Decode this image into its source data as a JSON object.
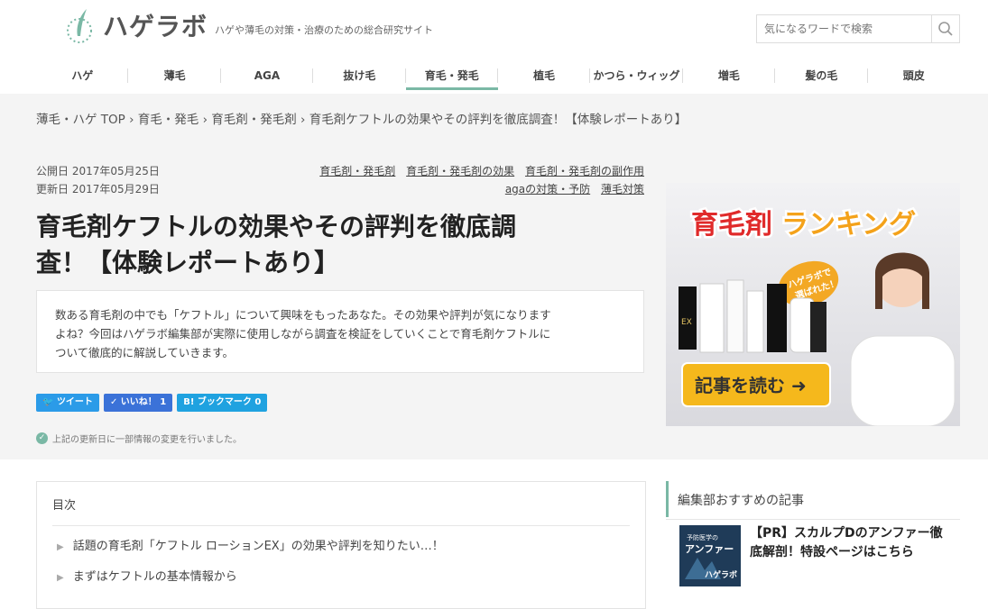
{
  "header": {
    "logo_text": "ハゲラボ",
    "tagline": "ハゲや薄毛の対策・治療のための総合研究サイト",
    "search_placeholder": "気になるワードで検索",
    "accent_color": "#7ab8a5"
  },
  "nav": {
    "items": [
      {
        "label": "ハゲ"
      },
      {
        "label": "薄毛"
      },
      {
        "label": "AGA"
      },
      {
        "label": "抜け毛"
      },
      {
        "label": "育毛・発毛"
      },
      {
        "label": "植毛"
      },
      {
        "label": "かつら・ウィッグ"
      },
      {
        "label": "増毛"
      },
      {
        "label": "髪の毛"
      },
      {
        "label": "頭皮"
      }
    ],
    "active": "育毛・発毛"
  },
  "breadcrumb": {
    "text": "薄毛・ハゲ TOP › 育毛・発毛 › 育毛剤・発毛剤 › 育毛剤ケフトルの効果やその評判を徹底調査！【体験レポートあり】"
  },
  "article": {
    "published": "公開日 2017年05月25日",
    "updated": "更新日 2017年05月29日",
    "tags_row1": [
      "育毛剤・発毛剤",
      "育毛剤・発毛剤の効果",
      "育毛剤・発毛剤の副作用"
    ],
    "tags_row2": [
      "agaの対策・予防",
      "薄毛対策"
    ],
    "title_line1": "育毛剤ケフトルの効果やその評判を徹底調",
    "title_line2": "査！【体験レポートあり】",
    "intro_line1": "数ある育毛剤の中でも「ケフトル」について興味をもったあなた。その効果や評判が気になります",
    "intro_line2": "よね？今回はハゲラボ編集部が実際に使用しながら調査を検証をしていくことで育毛剤ケフトルに",
    "intro_line3": "ついて徹底的に解説していきます。",
    "social": {
      "tweet": "ツイート",
      "like": "✓ いいね！ 1",
      "bookmark": "B! ブックマーク 0"
    },
    "update_note": "上記の更新日に一部情報の変更を行いました。"
  },
  "banner": {
    "heading_part1": "育毛剤",
    "heading_part2": "ランキング",
    "badge_line1": "ハゲラボで",
    "badge_line2": "選ばれた！",
    "cta": "記事を読む ➜",
    "bottle_label": "EX"
  },
  "toc": {
    "title": "目次",
    "items": [
      "話題の育毛剤「ケフトル ローションEX」の効果や評判を知りたい…！",
      "まずはケフトルの基本情報から"
    ]
  },
  "sidebar": {
    "heading": "編集部おすすめの記事",
    "article_title": "【PR】スカルプDのアンファー徹底解剖！特設ページはこちら",
    "thumb_line1": "予防医学の",
    "thumb_line2": "アンファー",
    "thumb_brand": "ハゲラボ"
  }
}
